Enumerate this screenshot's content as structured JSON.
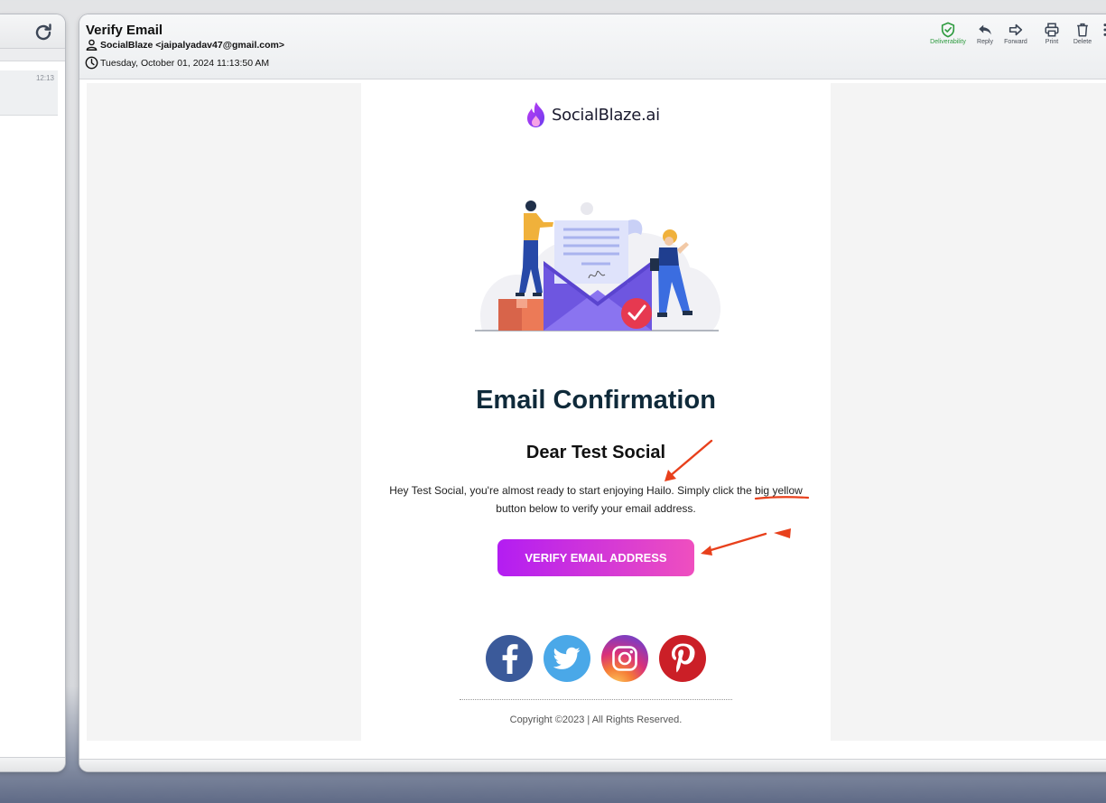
{
  "left_panel": {
    "items": [
      {
        "time": "12:13"
      }
    ]
  },
  "header": {
    "subject": "Verify Email",
    "from": "SocialBlaze <jaipalyadav47@gmail.com>",
    "date": "Tuesday, October 01, 2024 11:13:50 AM",
    "toolbar": {
      "deliverability": "Deliverability",
      "reply": "Reply",
      "forward": "Forward",
      "print": "Print",
      "delete": "Delete"
    }
  },
  "email": {
    "logo_text": "SocialBlaze.ai",
    "title": "Email Confirmation",
    "greeting": "Dear Test Social",
    "body_part1": "Hey Test Social, you're almost ready to start enjoying Hailo. Simply click the ",
    "body_highlight": "big yellow",
    "body_part2": " button below to verify your email address.",
    "button_label": "VERIFY EMAIL ADDRESS",
    "socials": [
      "facebook",
      "twitter",
      "instagram",
      "pinterest"
    ],
    "copyright": "Copyright ©2023 | All Rights Reserved."
  },
  "colors": {
    "button_start": "#b31df2",
    "button_end": "#ef4fbf",
    "title": "#0f2a3a",
    "annotation": "#e8401c",
    "deliverability": "#2e9b3f"
  }
}
